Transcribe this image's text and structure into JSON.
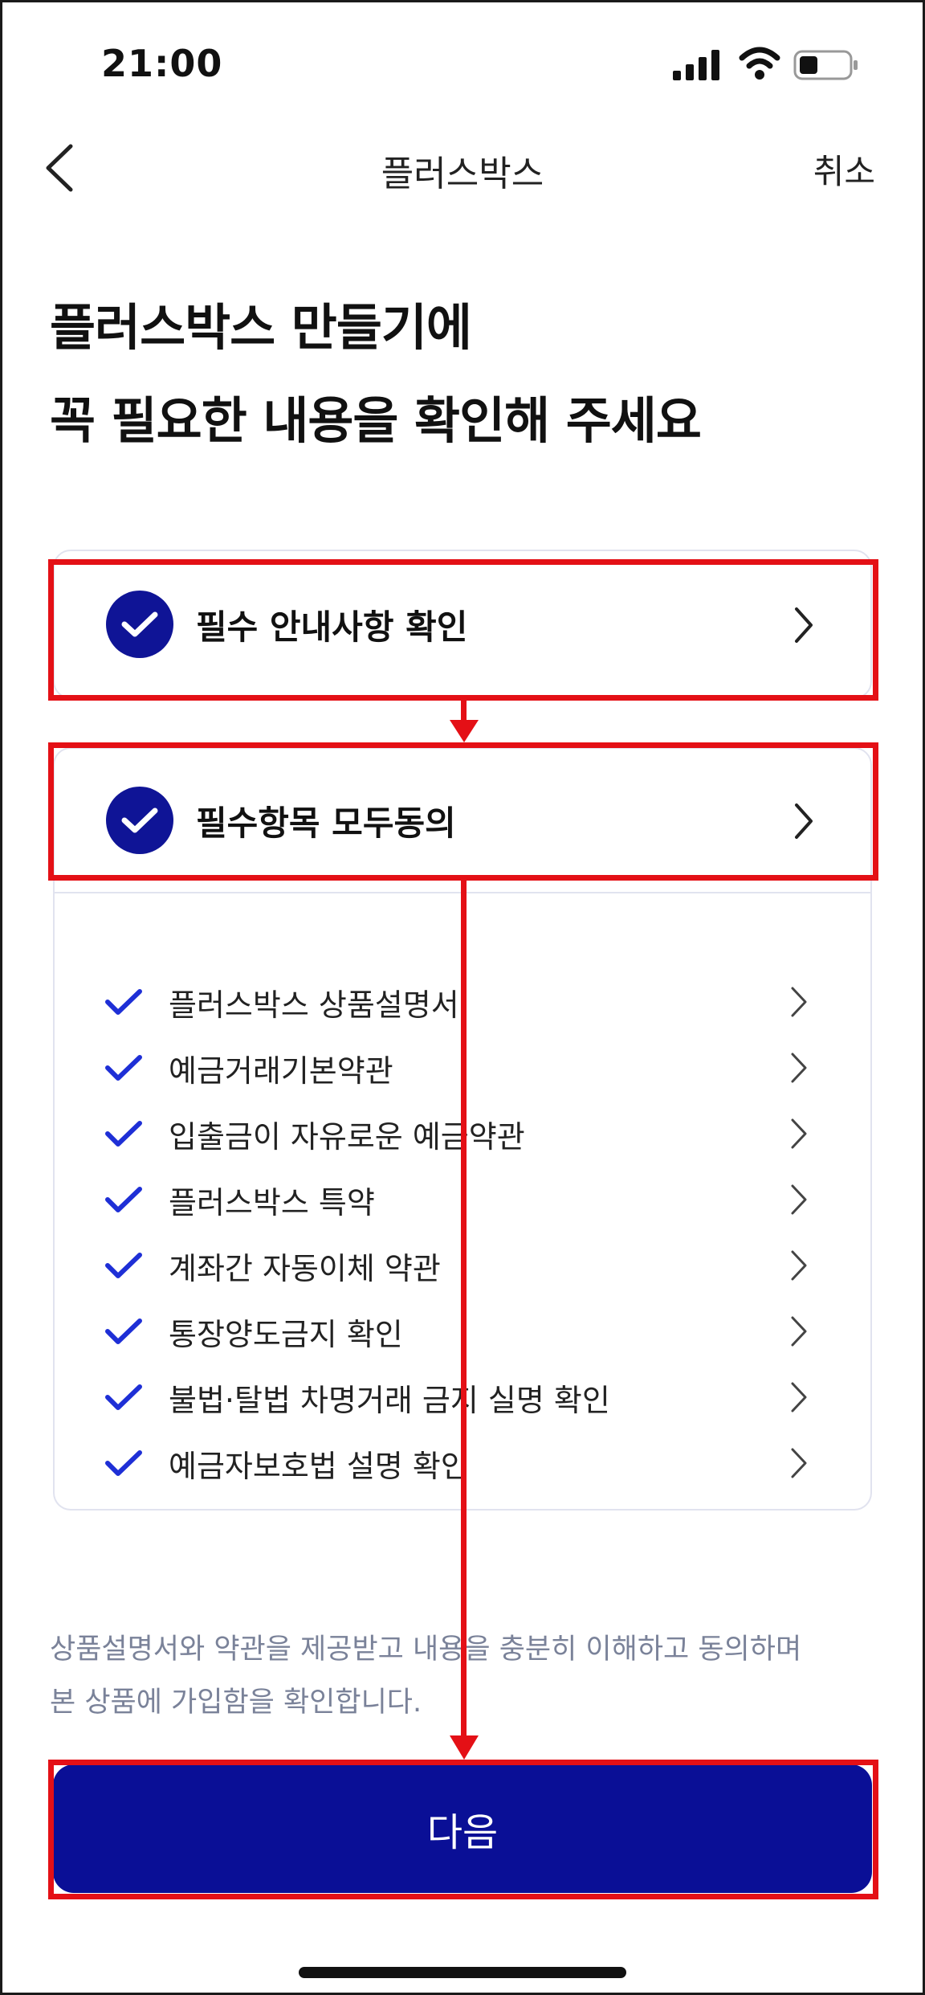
{
  "status_bar": {
    "time": "21:00"
  },
  "nav": {
    "title": "플러스박스",
    "cancel_label": "취소"
  },
  "headline": {
    "line1": "플러스박스 만들기에",
    "line2": "꼭 필요한 내용을 확인해 주세요"
  },
  "sections": [
    {
      "label": "필수 안내사항 확인",
      "checked": true
    },
    {
      "label": "필수항목 모두동의",
      "checked": true
    }
  ],
  "agreements": [
    {
      "label": "플러스박스 상품설명서",
      "checked": true
    },
    {
      "label": "예금거래기본약관",
      "checked": true
    },
    {
      "label": "입출금이 자유로운 예금약관",
      "checked": true
    },
    {
      "label": "플러스박스 특약",
      "checked": true
    },
    {
      "label": "계좌간 자동이체 약관",
      "checked": true
    },
    {
      "label": "통장양도금지 확인",
      "checked": true
    },
    {
      "label": "불법·탈법 차명거래 금지 실명 확인",
      "checked": true
    },
    {
      "label": "예금자보호법 설명 확인",
      "checked": true
    }
  ],
  "notice": {
    "line1": "상품설명서와 약관을 제공받고 내용을 충분히 이해하고 동의하며",
    "line2": "본 상품에 가입함을 확인합니다."
  },
  "next_button": {
    "label": "다음"
  },
  "colors": {
    "accent": "#0a0f96",
    "check": "#1e2fd6",
    "annotation": "#e41016",
    "notice_text": "#7a8299"
  }
}
